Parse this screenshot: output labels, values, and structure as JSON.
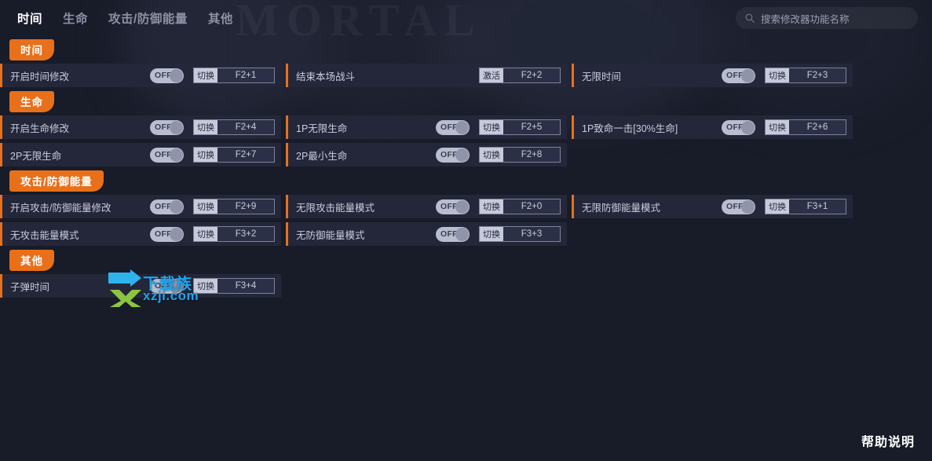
{
  "header": {
    "tabs": [
      {
        "label": "时间",
        "active": true
      },
      {
        "label": "生命",
        "active": false
      },
      {
        "label": "攻击/防御能量",
        "active": false
      },
      {
        "label": "其他",
        "active": false
      }
    ],
    "search": {
      "placeholder": "搜索修改器功能名称",
      "value": "",
      "icon": "search-icon"
    }
  },
  "background": {
    "art_word": "MORTAL"
  },
  "sections": [
    {
      "badge": "时间",
      "rows": [
        [
          {
            "label": "开启时间修改",
            "control": "toggle",
            "toggle_state": "OFF",
            "hotkey_action": "切换",
            "hotkey": "F2+1"
          },
          {
            "label": "结束本场战斗",
            "control": "activate",
            "toggle_state": "",
            "hotkey_action": "激活",
            "hotkey": "F2+2"
          },
          {
            "label": "无限时间",
            "control": "toggle",
            "toggle_state": "OFF",
            "hotkey_action": "切换",
            "hotkey": "F2+3"
          }
        ]
      ]
    },
    {
      "badge": "生命",
      "rows": [
        [
          {
            "label": "开启生命修改",
            "control": "toggle",
            "toggle_state": "OFF",
            "hotkey_action": "切换",
            "hotkey": "F2+4"
          },
          {
            "label": "1P无限生命",
            "control": "toggle",
            "toggle_state": "OFF",
            "hotkey_action": "切换",
            "hotkey": "F2+5"
          },
          {
            "label": "1P致命一击[30%生命]",
            "control": "toggle",
            "toggle_state": "OFF",
            "hotkey_action": "切换",
            "hotkey": "F2+6"
          }
        ],
        [
          {
            "label": "2P无限生命",
            "control": "toggle",
            "toggle_state": "OFF",
            "hotkey_action": "切换",
            "hotkey": "F2+7"
          },
          {
            "label": "2P最小生命",
            "control": "toggle",
            "toggle_state": "OFF",
            "hotkey_action": "切换",
            "hotkey": "F2+8"
          },
          {
            "label": "",
            "control": "empty",
            "toggle_state": "",
            "hotkey_action": "",
            "hotkey": ""
          }
        ]
      ]
    },
    {
      "badge": "攻击/防御能量",
      "rows": [
        [
          {
            "label": "开启攻击/防御能量修改",
            "control": "toggle",
            "toggle_state": "OFF",
            "hotkey_action": "切换",
            "hotkey": "F2+9"
          },
          {
            "label": "无限攻击能量模式",
            "control": "toggle",
            "toggle_state": "OFF",
            "hotkey_action": "切换",
            "hotkey": "F2+0"
          },
          {
            "label": "无限防御能量模式",
            "control": "toggle",
            "toggle_state": "OFF",
            "hotkey_action": "切换",
            "hotkey": "F3+1"
          }
        ],
        [
          {
            "label": "无攻击能量模式",
            "control": "toggle",
            "toggle_state": "OFF",
            "hotkey_action": "切换",
            "hotkey": "F3+2"
          },
          {
            "label": "无防御能量模式",
            "control": "toggle",
            "toggle_state": "OFF",
            "hotkey_action": "切换",
            "hotkey": "F3+3"
          },
          {
            "label": "",
            "control": "empty",
            "toggle_state": "",
            "hotkey_action": "",
            "hotkey": ""
          }
        ]
      ]
    },
    {
      "badge": "其他",
      "rows": [
        [
          {
            "label": "子弹时间",
            "control": "toggle",
            "toggle_state": "OFF",
            "hotkey_action": "切换",
            "hotkey": "F3+4"
          },
          {
            "label": "",
            "control": "empty",
            "toggle_state": "",
            "hotkey_action": "",
            "hotkey": ""
          },
          {
            "label": "",
            "control": "empty",
            "toggle_state": "",
            "hotkey_action": "",
            "hotkey": ""
          }
        ]
      ]
    }
  ],
  "watermark": {
    "top_text": "下载族",
    "bottom_text": "xzji.com"
  },
  "footer": {
    "help_label": "帮助说明"
  },
  "colors": {
    "accent": "#e8701a",
    "background": "#181b28",
    "row_bg": "#232739",
    "text": "#c9cddd",
    "watermark_blue": "#1ea5ef"
  }
}
